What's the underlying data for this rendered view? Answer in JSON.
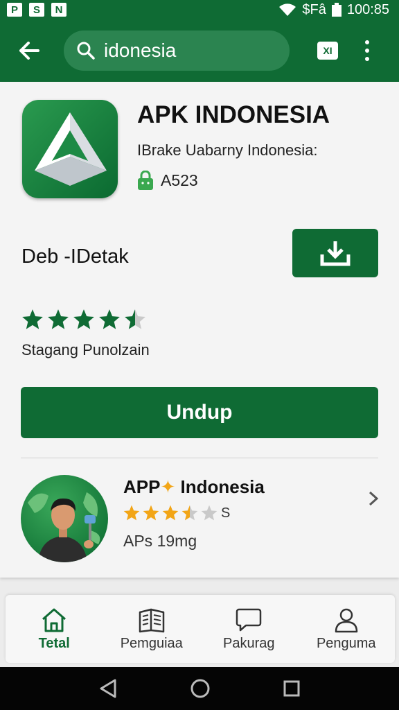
{
  "status_bar": {
    "left_icons": [
      "P",
      "S",
      "N"
    ],
    "signal_text": "$Fâ",
    "time": "100:85"
  },
  "toolbar": {
    "search_value": "idonesia",
    "square_icon_text": "XI"
  },
  "app": {
    "title": "APK INDONESIA",
    "subtitle": "IBrake Uabarny Indonesia:",
    "code": "A523",
    "detail_label": "Deb -IDetak",
    "rating_stars": 4.5,
    "rating_text": "Stagang Punolzain",
    "primary_button": "Undup"
  },
  "related": {
    "title_part1": "APP",
    "title_part2": "Indonesia",
    "rating_stars": 3.5,
    "rating_suffix": "S",
    "size_text": "APs 19mg"
  },
  "bottom_nav": [
    {
      "label": "Tetal",
      "icon": "home-icon",
      "active": true
    },
    {
      "label": "Pemguiaa",
      "icon": "book-icon",
      "active": false
    },
    {
      "label": "Pakurag",
      "icon": "chat-icon",
      "active": false
    },
    {
      "label": "Penguma",
      "icon": "person-icon",
      "active": false
    }
  ],
  "colors": {
    "brand_green": "#0f6b34",
    "star_green": "#0f6b34",
    "star_gold": "#f2a516"
  }
}
